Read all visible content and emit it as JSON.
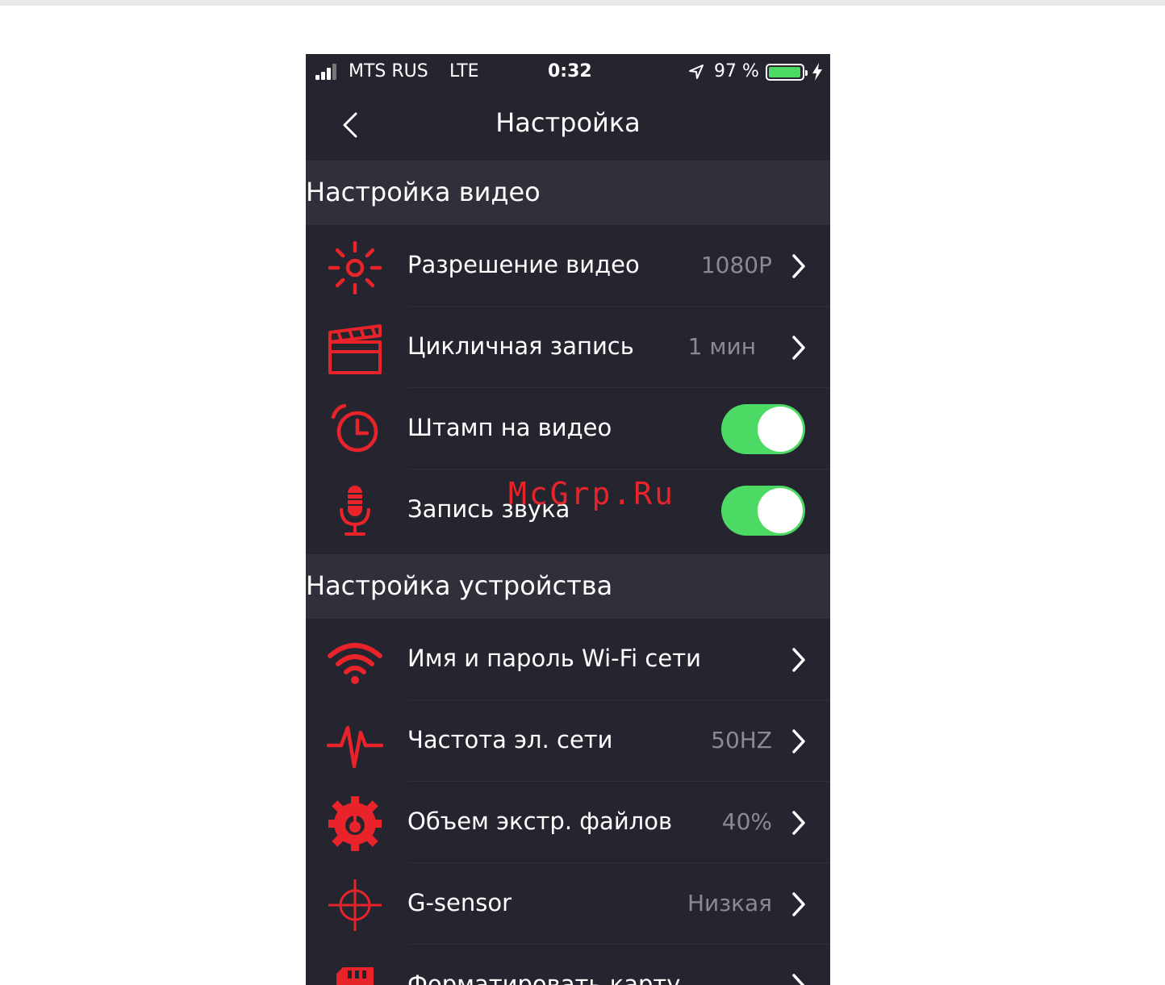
{
  "status_bar": {
    "carrier": "MTS RUS",
    "network": "LTE",
    "time": "0:32",
    "battery_percent": "97 %",
    "battery_level": 0.97,
    "icons": [
      "signal-icon",
      "location-arrow-icon",
      "battery-icon",
      "charging-bolt-icon"
    ]
  },
  "nav": {
    "title": "Настройка",
    "back_icon": "chevron-left-icon"
  },
  "sections": {
    "video": {
      "title": "Настройка видео",
      "items": [
        {
          "label": "Разрешение видео",
          "value": "1080P",
          "icon": "sun-brightness-icon",
          "control": "chevron"
        },
        {
          "label": "Цикличная запись",
          "value": "1 мин",
          "icon": "clapperboard-icon",
          "control": "chevron"
        },
        {
          "label": "Штамп на видео",
          "icon": "alarm-clock-icon",
          "control": "toggle",
          "on": true
        },
        {
          "label": "Запись звука",
          "icon": "microphone-icon",
          "control": "toggle",
          "on": true
        }
      ]
    },
    "device": {
      "title": "Настройка устройства",
      "items": [
        {
          "label": "Имя и пароль Wi-Fi сети",
          "value": "",
          "icon": "wifi-icon",
          "control": "chevron"
        },
        {
          "label": "Частота эл. сети",
          "value": "50HZ",
          "icon": "pulse-icon",
          "control": "chevron"
        },
        {
          "label": "Объем экстр. файлов",
          "value": "40%",
          "icon": "gear-timer-icon",
          "control": "chevron"
        },
        {
          "label": "G-sensor",
          "value": "Низкая",
          "icon": "crosshair-icon",
          "control": "chevron"
        },
        {
          "label": "Форматировать карту",
          "icon": "sd-card-icon",
          "control": "chevron"
        }
      ]
    }
  },
  "watermark": "McGrp.Ru",
  "colors": {
    "background": "#252530",
    "section_header": "#30303b",
    "icon_red": "#e8232a",
    "toggle_on": "#4cd964",
    "value_gray": "#8a8a94"
  }
}
